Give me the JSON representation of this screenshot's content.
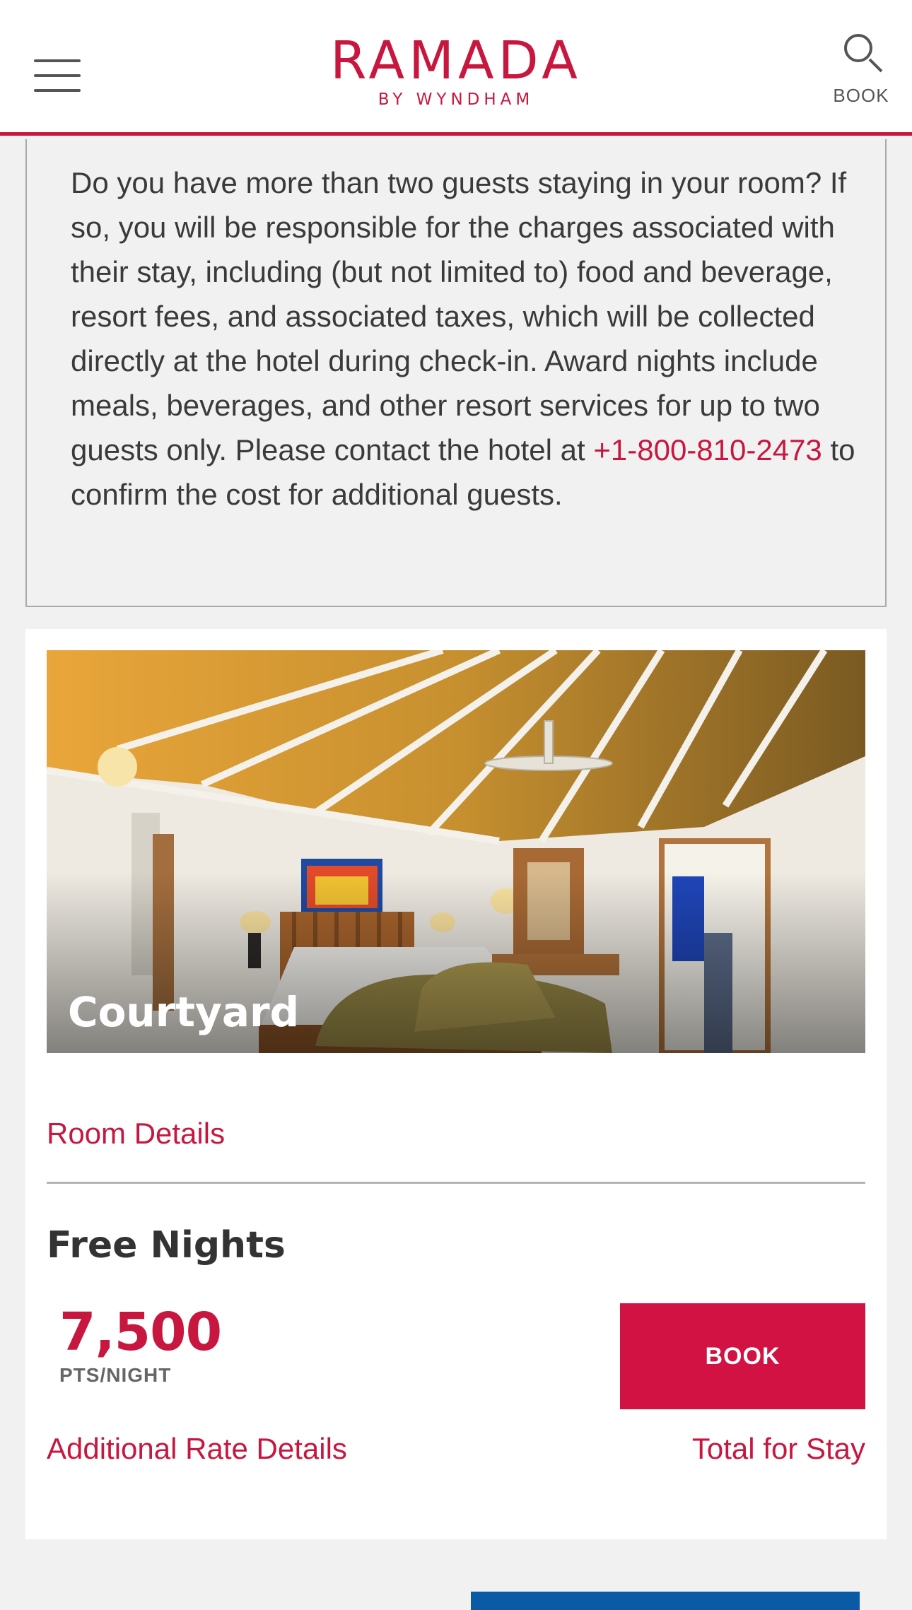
{
  "header": {
    "menu_icon": "hamburger-menu-icon",
    "logo_main": "RAMADA",
    "logo_sub": "BY WYNDHAM",
    "search_icon": "search-icon",
    "book_label": "BOOK",
    "accent_color": "#c8173f"
  },
  "notice": {
    "text_before_phone": "Do you have more than two guests staying in your room? If so, you will be responsible for the charges associated with their stay, including (but not limited to) food and beverage, resort fees, and associated taxes, which will be collected directly at the hotel during check-in. Award nights include meals, beverages, and other resort services for up to two guests only. Please contact the hotel at ",
    "phone": "+1-800-810-2473",
    "text_after_phone": " to confirm the cost for additional guests."
  },
  "room": {
    "name": "Courtyard",
    "details_link": "Room Details",
    "rate_title": "Free Nights",
    "points": "7,500",
    "points_unit": "PTS/NIGHT",
    "book_button": "BOOK",
    "additional_rate_link": "Additional Rate Details",
    "total_link": "Total for Stay",
    "button_color": "#d11242"
  }
}
